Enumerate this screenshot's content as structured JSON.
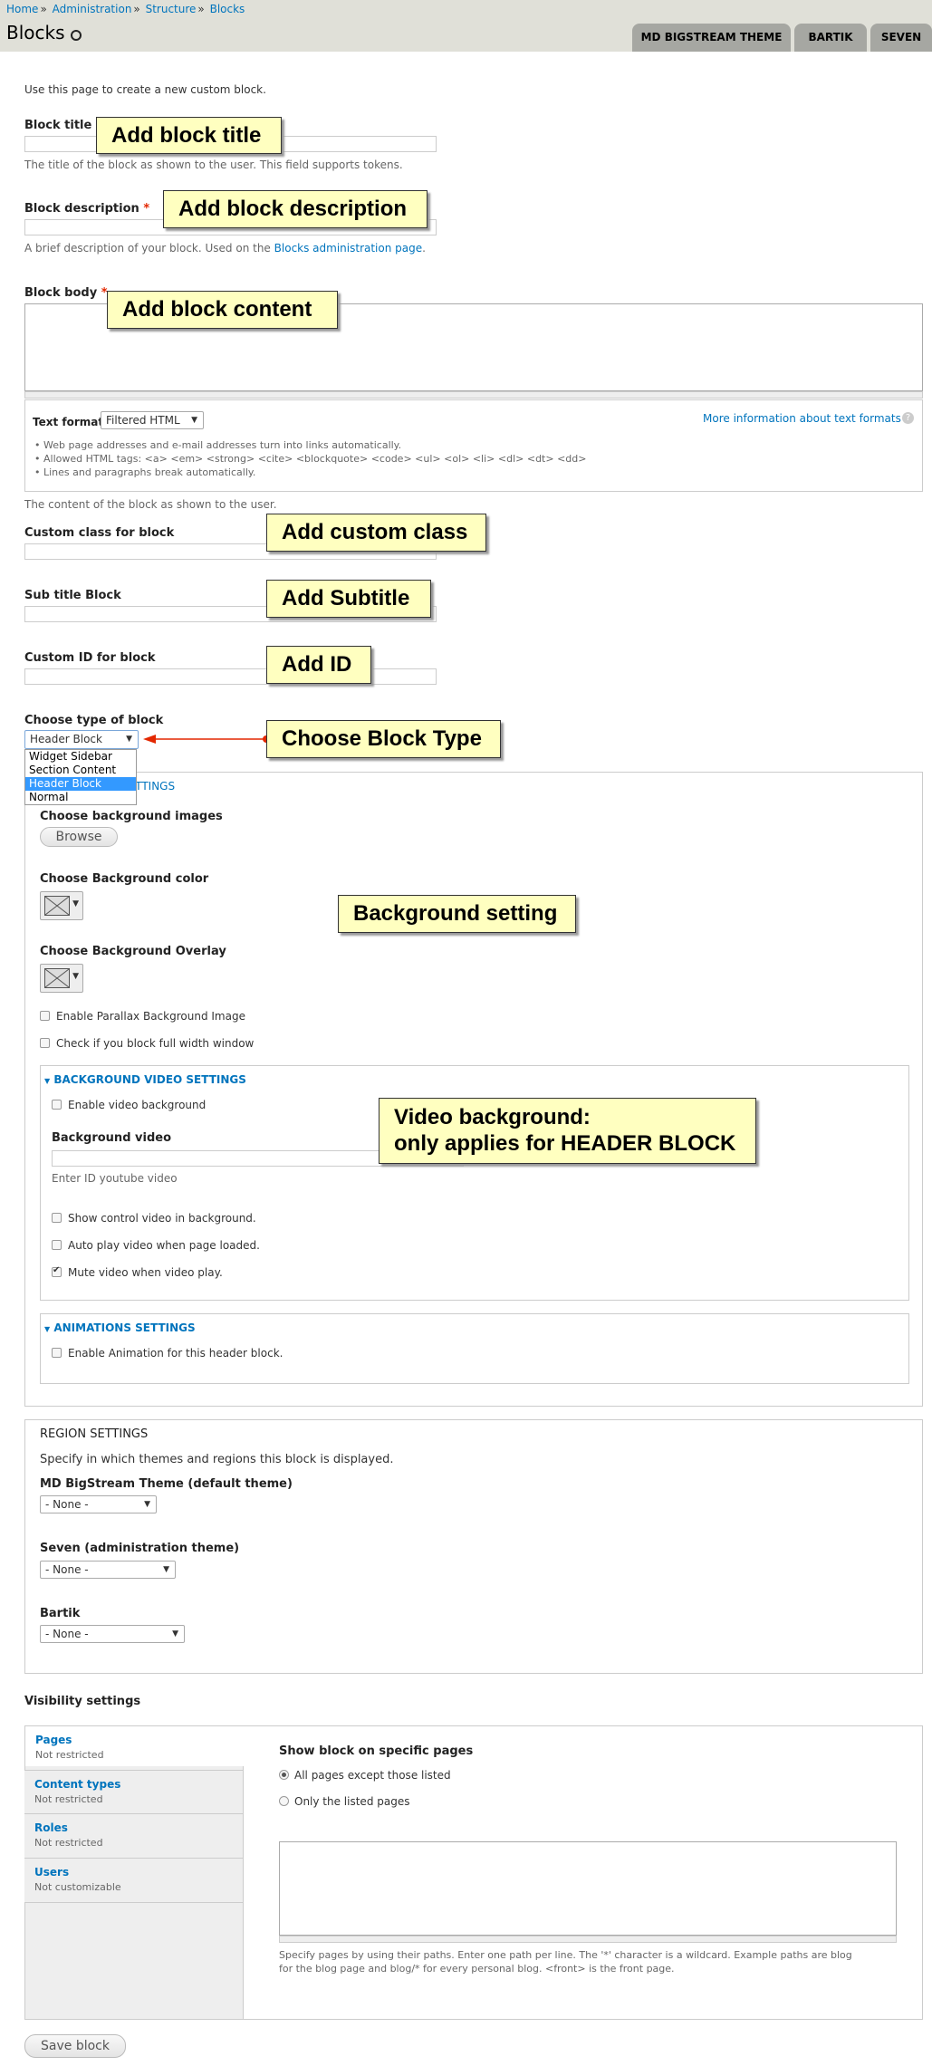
{
  "breadcrumb": [
    "Home",
    "Administration",
    "Structure",
    "Blocks"
  ],
  "page_title": "Blocks",
  "tabs": [
    "MD BIGSTREAM THEME",
    "BARTIK",
    "SEVEN"
  ],
  "intro": "Use this page to create a new custom block.",
  "block_title": {
    "label": "Block title",
    "help": "The title of the block as shown to the user. This field supports tokens.",
    "callout": "Add block title"
  },
  "block_description": {
    "label": "Block description",
    "required": "*",
    "help_prefix": "A brief description of your block. Used on the",
    "help_link": "Blocks administration page",
    "help_suffix": ".",
    "callout": "Add block description"
  },
  "block_body": {
    "label": "Block body",
    "required": "*",
    "callout": "Add block content",
    "text_format_label": "Text format",
    "text_format_value": "Filtered HTML",
    "more_info": "More information about text formats",
    "tips": [
      "Web page addresses and e-mail addresses turn into links automatically.",
      "Allowed HTML tags: <a> <em> <strong> <cite> <blockquote> <code> <ul> <ol> <li> <dl> <dt> <dd>",
      "Lines and paragraphs break automatically."
    ],
    "help": "The content of the block as shown to the user."
  },
  "custom_class": {
    "label": "Custom class for block",
    "callout": "Add custom class"
  },
  "sub_title": {
    "label": "Sub title Block",
    "callout": "Add Subtitle"
  },
  "custom_id": {
    "label": "Custom ID for block",
    "callout": "Add ID"
  },
  "block_type": {
    "label": "Choose type of block",
    "selected": "Header Block",
    "options": [
      "Widget Sidebar",
      "Section Content",
      "Header Block",
      "Normal"
    ],
    "callout": "Choose Block Type"
  },
  "background": {
    "legend_partial": "SETTINGS",
    "images_label": "Choose background images",
    "browse": "Browse",
    "color_label": "Choose Background color",
    "overlay_label": "Choose Background Overlay",
    "callout": "Background setting",
    "parallax": "Enable Parallax Background Image",
    "full_width": "Check if you block full width window"
  },
  "video": {
    "legend": "BACKGROUND VIDEO SETTINGS",
    "enable": "Enable video background",
    "label": "Background video",
    "help": "Enter ID youtube video",
    "show_control": "Show control video in background.",
    "autoplay": "Auto play video when page loaded.",
    "mute": "Mute video when video play.",
    "callout_line1": "Video background:",
    "callout_line2": "only applies for HEADER BLOCK"
  },
  "animations": {
    "legend": "ANIMATIONS SETTINGS",
    "enable": "Enable Animation for this header block."
  },
  "region": {
    "legend": "REGION SETTINGS",
    "desc": "Specify in which themes and regions this block is displayed.",
    "themes": [
      {
        "label": "MD BigStream Theme (default theme)",
        "value": "- None -"
      },
      {
        "label": "Seven (administration theme)",
        "value": "- None -"
      },
      {
        "label": "Bartik",
        "value": "- None -"
      }
    ]
  },
  "visibility": {
    "title": "Visibility settings",
    "tabs": [
      {
        "title": "Pages",
        "summary": "Not restricted"
      },
      {
        "title": "Content types",
        "summary": "Not restricted"
      },
      {
        "title": "Roles",
        "summary": "Not restricted"
      },
      {
        "title": "Users",
        "summary": "Not customizable"
      }
    ],
    "pages_heading": "Show block on specific pages",
    "radio_all": "All pages except those listed",
    "radio_only": "Only the listed pages",
    "help_line1": "Specify pages by using their paths. Enter one path per line. The '*' character is a wildcard. Example paths are blog",
    "help_line2": "for the blog page and blog/* for every personal blog. <front> is the front page."
  },
  "save": "Save block"
}
